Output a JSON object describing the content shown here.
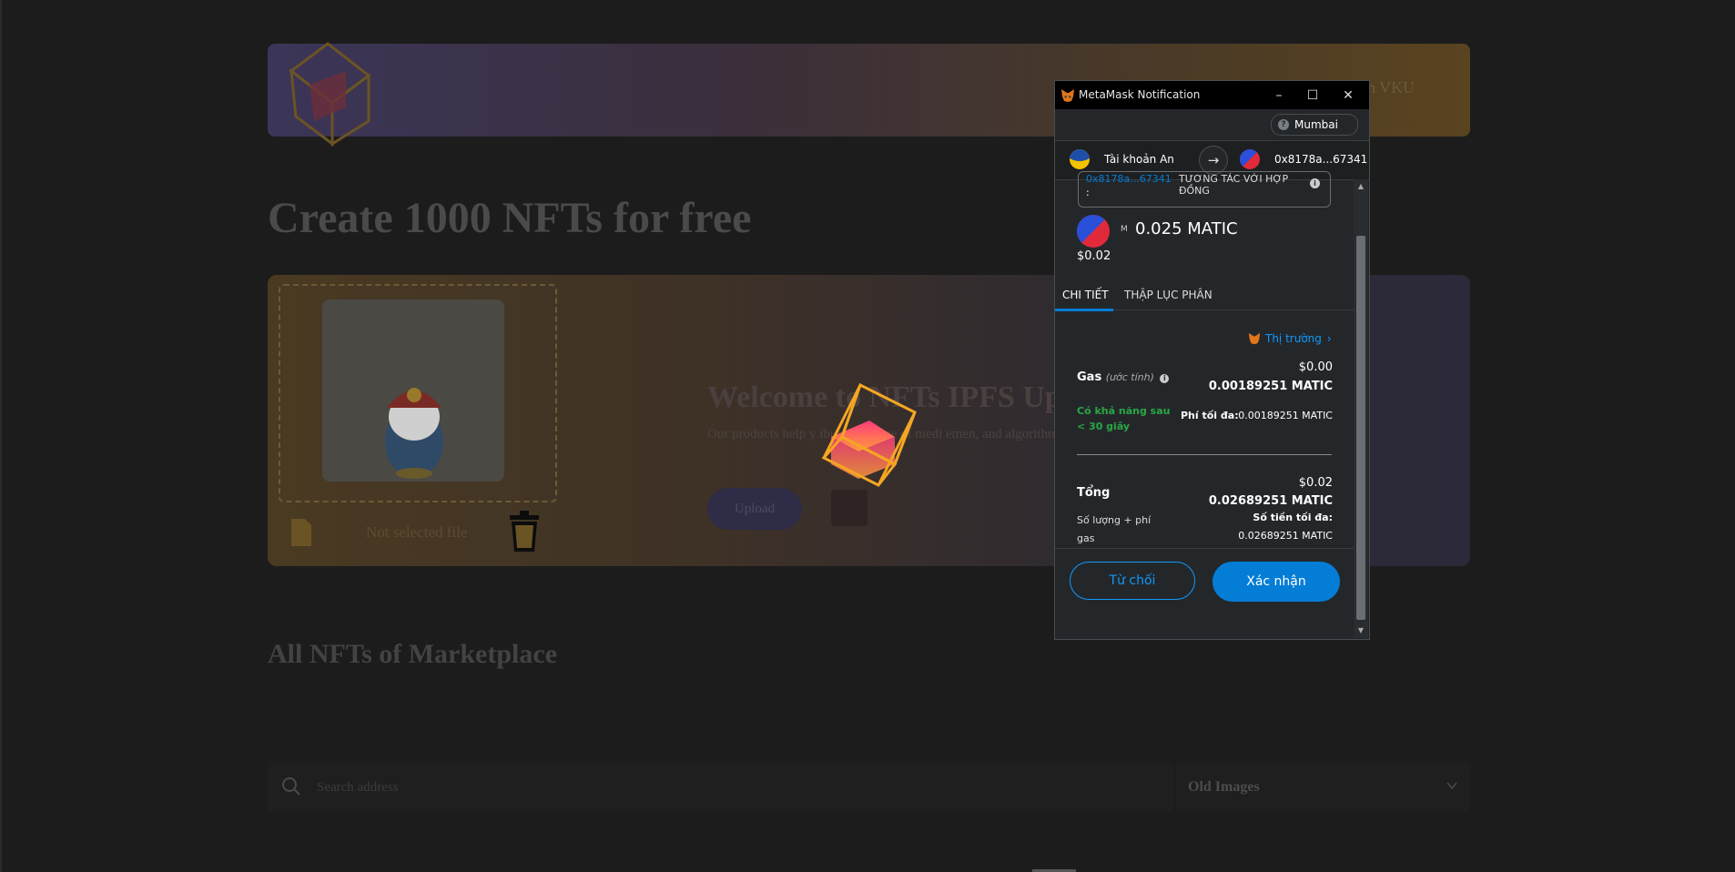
{
  "page": {
    "banner_user": "uyen VKU",
    "title": "Create 1000 NFTs for free",
    "upload": {
      "not_selected": "Not selected file",
      "welcome_title": "Welcome to NFTs IPFS Uplo",
      "description": "Our products help y             ibute any type of medi                                                                                                  emen, and algorithms that          ive agency.",
      "upload_button": "Upload"
    },
    "section_title": "All NFTs of Marketplace",
    "search": {
      "placeholder": "Search address"
    },
    "sort": {
      "selected": "Old Images"
    }
  },
  "metamask": {
    "window_title": "MetaMask Notification",
    "network": "Mumbai",
    "from_account": "Tài khoản An",
    "to_account": "0x8178a...67341",
    "origin_address": "0x8178a...67341",
    "origin_colon": ":",
    "origin_type": "TƯƠNG TÁC VỚI HỢP ĐỒNG",
    "token_symbol_prefix": "M",
    "amount": "0.025 MATIC",
    "amount_usd": "$0.02",
    "tabs": [
      "CHI TIẾT",
      "THẬP LỤC PHÂN"
    ],
    "market_link": "Thị trường",
    "gas_label": "Gas",
    "gas_sub": "(ước tính)",
    "gas_usd": "$0.00",
    "gas_matic": "0.00189251 MATIC",
    "likely_text": "Có khả năng sau < 30 giây",
    "max_fee_label": "Phí tối đa:",
    "max_fee_value": "0.00189251 MATIC",
    "total_label": "Tổng",
    "total_usd": "$0.02",
    "total_matic": "0.02689251 MATIC",
    "amount_plus_gas": "Số lượng + phí gas",
    "max_amount_label": "Số tiền tối đa:",
    "max_amount_value": "0.02689251 MATIC",
    "reject_button": "Từ chối",
    "confirm_button": "Xác nhận"
  },
  "colors": {
    "metamask_blue": "#037dd6",
    "link_blue": "#1098fc",
    "success_green": "#28a745",
    "cube_orange": "#f5a623"
  }
}
